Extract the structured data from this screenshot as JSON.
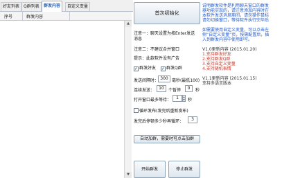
{
  "tabs": [
    "好友列表",
    "Q群列表",
    "群发内容",
    "自定义变量"
  ],
  "active_tab_index": 2,
  "table": {
    "columns": [
      "序号",
      "群发内容"
    ]
  },
  "controls": {
    "init_button": "首次初始化",
    "note1": "注意一：聊天设置为按Enter发送",
    "note1_cont": "消息",
    "note2": "注意二：不建议合并窗口",
    "note3": "提示：此款软件没有广告",
    "cb_friend": "群发好友",
    "cb_group": "群发Q群",
    "send_interval_label": "发送间隔时：",
    "send_interval_value": "300",
    "send_interval_unit": "毫秒(最低100)",
    "continuous_label": "连续发送：",
    "continuous_value": "10",
    "pause_label": "个暂停",
    "pause_value": "0",
    "pause_unit": "秒",
    "open_window_label": "打开窗口最多等待：",
    "open_window_value": "1",
    "open_window_unit": "秒",
    "loop_label": "循环发布(发完后重新发布)",
    "resend_label": "发完后停顿多少秒再循环：",
    "resend_value": "3",
    "join_group_button": "自动加群，需要时可点击加群",
    "start_button": "开始群发",
    "stop_button": "停止群发"
  },
  "right_panel": {
    "lines": [
      "说明群发软件是利用聊天窗口的群发",
      "器功能实现的，请注意添加内容时在",
      "本软件发送消息期间，请勿操作鼠标",
      "请勿切换窗口，等待软件执行完毕后",
      "",
      "如需要使用自定义变量，可以点击左",
      "侧“自定义变量”页，按需配置后，插",
      "入到群发内容中使用即可。",
      "",
      "V1.0更新内容 (2015.01.20)",
      "1.支持群发好友",
      "2.支持群发Q群",
      "3.支持自定义变量",
      "4.支持随机表情",
      "",
      "V1.1更新内容 (2015.01.15)",
      "支持多语言版本"
    ]
  }
}
